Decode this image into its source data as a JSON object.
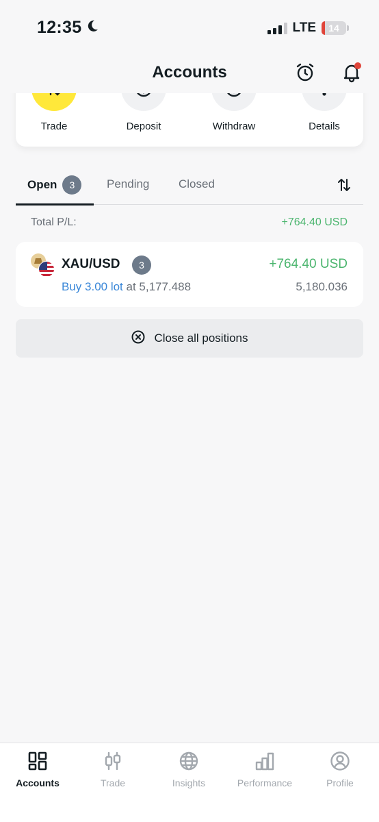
{
  "status_bar": {
    "time": "12:35",
    "network": "LTE",
    "battery": "14",
    "battery_percent": 14,
    "icons": [
      "moon-icon",
      "signal-icon",
      "battery-icon"
    ]
  },
  "header": {
    "title": "Accounts",
    "icons": [
      "alarm-clock-icon",
      "bell-icon"
    ]
  },
  "actions": [
    {
      "label": "Trade",
      "icon": "trade-icon"
    },
    {
      "label": "Deposit",
      "icon": "deposit-icon"
    },
    {
      "label": "Withdraw",
      "icon": "withdraw-icon"
    },
    {
      "label": "Details",
      "icon": "more-icon"
    }
  ],
  "tabs": {
    "open": {
      "label": "Open",
      "count": "3"
    },
    "pending": {
      "label": "Pending"
    },
    "closed": {
      "label": "Closed"
    },
    "sort_icon": "sort-arrows-icon"
  },
  "totals": {
    "label": "Total P/L:",
    "value": "+764.40 USD"
  },
  "position": {
    "symbol": "XAU/USD",
    "count": "3",
    "pl": "+764.40 USD",
    "side": "Buy 3.00 lot",
    "at_text": "at 5,177.488",
    "current_price": "5,180.036"
  },
  "close_all": {
    "label": "Close all positions",
    "icon": "close-circle-icon"
  },
  "bottom_nav": [
    {
      "label": "Accounts",
      "icon": "accounts-icon",
      "active": true
    },
    {
      "label": "Trade",
      "icon": "candlestick-icon",
      "active": false
    },
    {
      "label": "Insights",
      "icon": "globe-icon",
      "active": false
    },
    {
      "label": "Performance",
      "icon": "bar-chart-icon",
      "active": false
    },
    {
      "label": "Profile",
      "icon": "profile-icon",
      "active": false
    }
  ],
  "colors": {
    "accent_yellow": "#ffe83a",
    "profit_green": "#4bb56e",
    "buy_blue": "#3a87d8",
    "badge_gray": "#6d7a8a",
    "notification_red": "#e0453a"
  }
}
